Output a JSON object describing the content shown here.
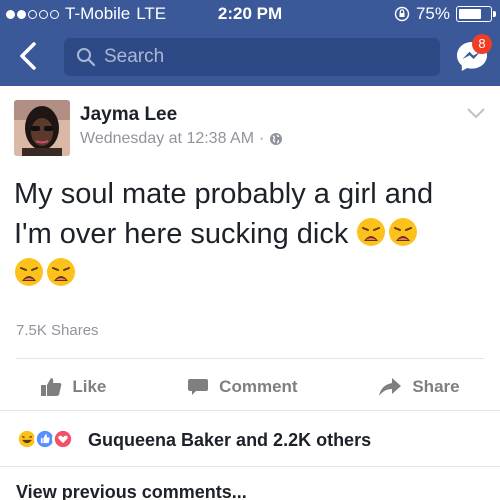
{
  "status_bar": {
    "carrier": "T-Mobile",
    "network": "LTE",
    "time": "2:20 PM",
    "battery": "75%",
    "battery_level": 0.75,
    "signal_bars_filled": 2,
    "signal_bars_total": 5
  },
  "nav": {
    "search_placeholder": "Search",
    "messenger_badge": "8",
    "background_color": "#3b5998"
  },
  "post": {
    "author": "Jayma Lee",
    "timestamp": "Wednesday at 12:38 AM",
    "audience_separator": "·",
    "audience_icon": "globe-icon",
    "text_line1": "My soul mate probably a girl and",
    "text_line2": "I'm over here sucking dick",
    "emoji": "weary-face",
    "shares": "7.5K Shares"
  },
  "actions": {
    "like": "Like",
    "comment": "Comment",
    "share": "Share"
  },
  "reactions": {
    "icons": [
      "haha-reaction",
      "like-reaction",
      "love-reaction"
    ],
    "summary": "Guqueena Baker and 2.2K others"
  },
  "comments": {
    "view_previous": "View previous comments..."
  }
}
